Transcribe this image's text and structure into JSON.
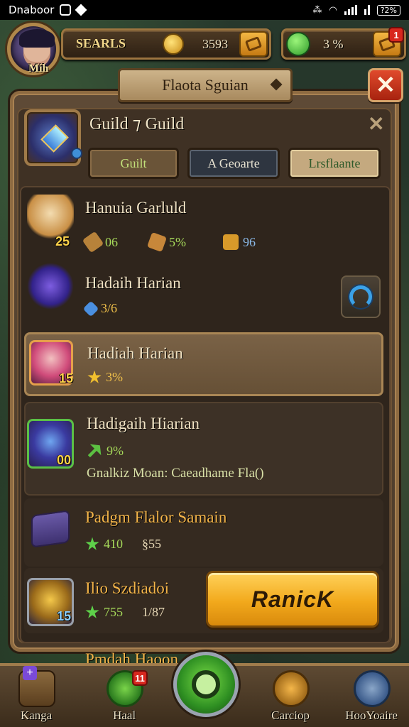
{
  "status_bar": {
    "carrier": "Dnaboor",
    "battery": "?2%"
  },
  "hud": {
    "player_name": "Mih",
    "gold_label": "SEARLS",
    "gold_value": "3593",
    "gems_value": "3 %",
    "gems_badge": "1"
  },
  "panel": {
    "title": "Flaota Sguian",
    "close_glyph": "✕"
  },
  "guild": {
    "title": "Guild ⁊ Guild",
    "close_glyph": "✕",
    "tabs": [
      {
        "label": "Guilt"
      },
      {
        "label": "A Geoarte"
      },
      {
        "label": "Lrsflaante"
      }
    ]
  },
  "members": [
    {
      "name": "Hanuia Garluld",
      "level": "25",
      "stats": [
        {
          "icon": "hammer-icon",
          "value": "06"
        },
        {
          "icon": "axe-icon",
          "value": "5%"
        },
        {
          "icon": "shield-icon",
          "value": "96"
        }
      ]
    },
    {
      "name": "Hadaih Harian",
      "stats": [
        {
          "icon": "crystal-icon",
          "value": "3/6"
        }
      ]
    },
    {
      "name": "Hadiah Harian",
      "level": "15",
      "stats": [
        {
          "icon": "star-icon",
          "value": "3%"
        }
      ]
    },
    {
      "name": "Hadigaih Hiarian",
      "level": "00",
      "stats": [
        {
          "icon": "arrow-icon",
          "value": "9%"
        }
      ],
      "description": "Gnalkiz Moan: Caeadhame Fla()"
    },
    {
      "name": "Padgm Flalor Samain",
      "stats": [
        {
          "icon": "star-icon",
          "value": "410"
        },
        {
          "icon": "text",
          "value": "§55"
        }
      ]
    },
    {
      "name": "Ilio Szdiadoi",
      "level": "15",
      "stats": [
        {
          "icon": "star-icon",
          "value": "755"
        },
        {
          "icon": "text",
          "value": "1/87"
        }
      ]
    },
    {
      "name": "Pmdah Haoon"
    }
  ],
  "rank_button": "RanicK",
  "bottom_nav": [
    {
      "label": "Kanga",
      "icon": "chest-icon"
    },
    {
      "label": "Haal",
      "icon": "bow-icon",
      "badge": "11"
    },
    {
      "label": "",
      "icon": "search-icon"
    },
    {
      "label": "Carciop",
      "icon": "map-icon"
    },
    {
      "label": "HooYoaire",
      "icon": "settings-icon"
    }
  ],
  "colors": {
    "panel_bg": "#4b3a29",
    "accent_gold": "#f2a91c",
    "close_red": "#c02a14",
    "highlight_row": "#7a6246"
  }
}
